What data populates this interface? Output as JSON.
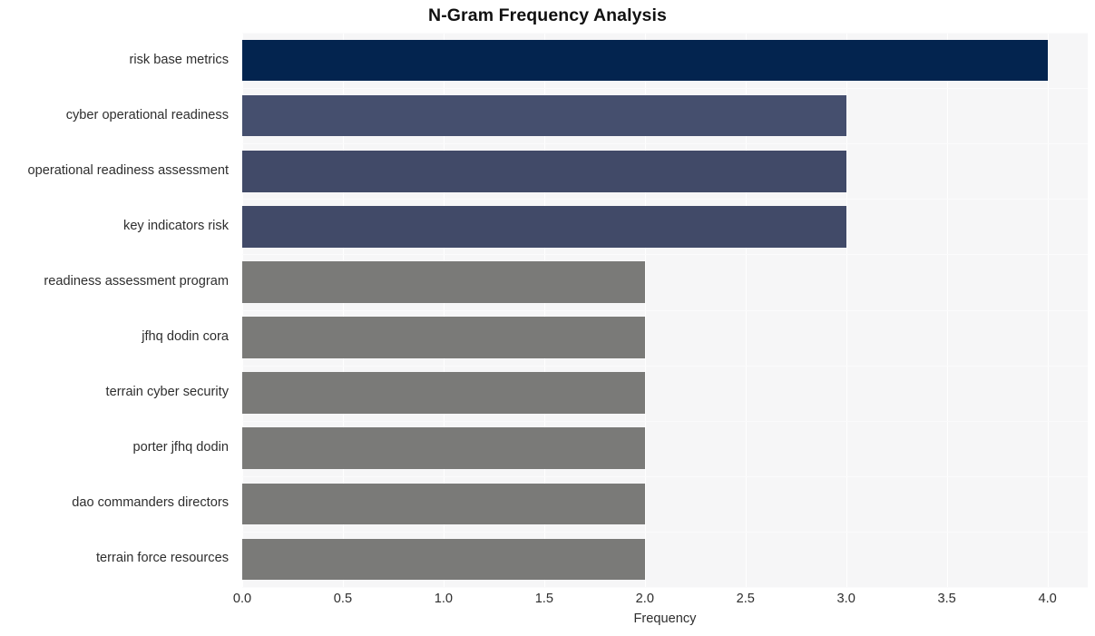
{
  "chart_data": {
    "type": "bar",
    "orientation": "horizontal",
    "title": "N-Gram Frequency Analysis",
    "xlabel": "Frequency",
    "ylabel": "",
    "xlim": [
      0.0,
      4.2
    ],
    "xticks": [
      "0.0",
      "0.5",
      "1.0",
      "1.5",
      "2.0",
      "2.5",
      "3.0",
      "3.5",
      "4.0"
    ],
    "xtick_values": [
      0.0,
      0.5,
      1.0,
      1.5,
      2.0,
      2.5,
      3.0,
      3.5,
      4.0
    ],
    "grid": true,
    "legend": "none",
    "categories": [
      "risk base metrics",
      "cyber operational readiness",
      "operational readiness assessment",
      "key indicators risk",
      "readiness assessment program",
      "jfhq dodin cora",
      "terrain cyber security",
      "porter jfhq dodin",
      "dao commanders directors",
      "terrain force resources"
    ],
    "values": [
      4,
      3,
      3,
      3,
      2,
      2,
      2,
      2,
      2,
      2
    ],
    "bar_colors": [
      "#03244f",
      "#454f6e",
      "#414a68",
      "#414a68",
      "#7a7a78",
      "#7a7a78",
      "#7a7a78",
      "#7a7a78",
      "#7a7a78",
      "#7a7a78"
    ],
    "plot_background": "#f6f6f7",
    "grid_color": "#ffffff",
    "figure_background": "#ffffff"
  }
}
